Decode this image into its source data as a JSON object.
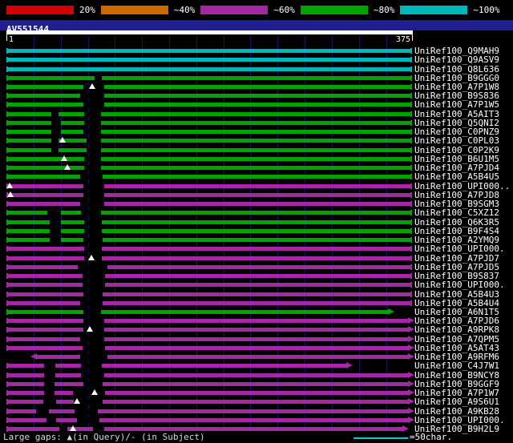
{
  "legend": {
    "segments": [
      {
        "label": "20%",
        "color": "#d40000"
      },
      {
        "label": "~40%",
        "color": "#cc6a00"
      },
      {
        "label": "~60%",
        "color": "#a428a4"
      },
      {
        "label": "~80%",
        "color": "#00a300"
      },
      {
        "label": "~100%",
        "color": "#00b7b7"
      }
    ]
  },
  "query": {
    "name": "AV551544",
    "start_label": "1",
    "end_label": "375",
    "length": 375
  },
  "footer": {
    "gaps_note": "Large gaps: ▲(in Query)/- (in Subject)",
    "scale_note": "=50char.",
    "scale_chars": 50
  },
  "colors": {
    "background": "#000000",
    "grid": "#15155d",
    "ruler_band": "#1f1f8f",
    "scale_line": "#00cccc",
    "text": "#ffffff"
  },
  "chart_data": {
    "type": "bar",
    "subtype": "blast-alignment-overview",
    "title": "AV551544",
    "x_axis": {
      "label": "query position",
      "min": 1,
      "max": 375,
      "gridline_interval": 25
    },
    "legend_position": "top",
    "band_colors": {
      "20%": "#d40000",
      "~40%": "#cc6a00",
      "~60%": "#a428a4",
      "~80%": "#00a300",
      "~100%": "#00b7b7"
    },
    "hits": [
      {
        "label": "UniRef100_Q9MAH9",
        "band": "~100%",
        "q_start": 1,
        "q_end": 375
      },
      {
        "label": "UniRef100_Q9ASV9",
        "band": "~100%",
        "q_start": 1,
        "q_end": 375
      },
      {
        "label": "UniRef100_Q8L636",
        "band": "~100%",
        "q_start": 1,
        "q_end": 375
      },
      {
        "label": "UniRef100_B9GGG0",
        "band": "~80%",
        "q_start": 1,
        "q_end": 375,
        "gaps": [
          [
            82,
            7
          ]
        ]
      },
      {
        "label": "UniRef100_A7P1W8",
        "band": "~80%",
        "q_start": 1,
        "q_end": 375,
        "gaps": [
          [
            72,
            19
          ]
        ],
        "query_gap_marks": [
          80
        ]
      },
      {
        "label": "UniRef100_B9S836",
        "band": "~80%",
        "q_start": 1,
        "q_end": 375,
        "gaps": [
          [
            69,
            22
          ]
        ]
      },
      {
        "label": "UniRef100_A7P1W5",
        "band": "~80%",
        "q_start": 1,
        "q_end": 375,
        "gaps": [
          [
            72,
            19
          ]
        ]
      },
      {
        "label": "UniRef100_A5AIT3",
        "band": "~80%",
        "q_start": 1,
        "q_end": 375,
        "gaps": [
          [
            42,
            7
          ],
          [
            73,
            15
          ]
        ]
      },
      {
        "label": "UniRef100_Q5QNI2",
        "band": "~80%",
        "q_start": 1,
        "q_end": 375,
        "gaps": [
          [
            42,
            9
          ],
          [
            73,
            15
          ]
        ]
      },
      {
        "label": "UniRef100_C0PNZ9",
        "band": "~80%",
        "q_start": 1,
        "q_end": 375,
        "gaps": [
          [
            42,
            9
          ],
          [
            72,
            16
          ]
        ]
      },
      {
        "label": "UniRef100_C0PL03",
        "band": "~80%",
        "q_start": 1,
        "q_end": 375,
        "gaps": [
          [
            42,
            7
          ],
          [
            75,
            13
          ]
        ],
        "query_gap_marks": [
          53
        ]
      },
      {
        "label": "UniRef100_C0P2K9",
        "band": "~80%",
        "q_start": 1,
        "q_end": 375,
        "gaps": [
          [
            42,
            7
          ],
          [
            75,
            13
          ]
        ]
      },
      {
        "label": "UniRef100_B6U1M5",
        "band": "~80%",
        "q_start": 1,
        "q_end": 375,
        "gaps": [
          [
            73,
            15
          ]
        ],
        "query_gap_marks": [
          54
        ]
      },
      {
        "label": "UniRef100_A7PJD4",
        "band": "~80%",
        "q_start": 1,
        "q_end": 375,
        "gaps": [
          [
            73,
            15
          ]
        ],
        "query_gap_marks": [
          57
        ]
      },
      {
        "label": "UniRef100_A5B4U5",
        "band": "~80%",
        "q_start": 1,
        "q_end": 375,
        "gaps": [
          [
            69,
            21
          ]
        ]
      },
      {
        "label": "UniRef100_UPI000..",
        "band": "~60%",
        "q_start": 1,
        "q_end": 375,
        "gaps": [
          [
            72,
            19
          ]
        ],
        "query_gap_marks": [
          4
        ]
      },
      {
        "label": "UniRef100_A7PJD8",
        "band": "~60%",
        "q_start": 1,
        "q_end": 375,
        "gaps": [
          [
            72,
            19
          ]
        ],
        "query_gap_marks": [
          5
        ]
      },
      {
        "label": "UniRef100_B9SGM3",
        "band": "~60%",
        "q_start": 1,
        "q_end": 375,
        "gaps": [
          [
            69,
            22
          ]
        ]
      },
      {
        "label": "UniRef100_C5XZ12",
        "band": "~80%",
        "q_start": 1,
        "q_end": 375,
        "gaps": [
          [
            39,
            12
          ],
          [
            70,
            18
          ]
        ]
      },
      {
        "label": "UniRef100_Q6K3R5",
        "band": "~80%",
        "q_start": 1,
        "q_end": 375,
        "gaps": [
          [
            41,
            10
          ],
          [
            73,
            16
          ]
        ]
      },
      {
        "label": "UniRef100_B9F4S4",
        "band": "~80%",
        "q_start": 1,
        "q_end": 375,
        "gaps": [
          [
            41,
            10
          ],
          [
            73,
            16
          ]
        ]
      },
      {
        "label": "UniRef100_A2YMQ9",
        "band": "~80%",
        "q_start": 1,
        "q_end": 375,
        "gaps": [
          [
            41,
            10
          ],
          [
            72,
            18
          ]
        ]
      },
      {
        "label": "UniRef100_UPI000.",
        "band": "~60%",
        "q_start": 1,
        "q_end": 375,
        "gaps": [
          [
            73,
            16
          ]
        ]
      },
      {
        "label": "UniRef100_A7PJD7",
        "band": "~60%",
        "q_start": 1,
        "q_end": 375,
        "gaps": [
          [
            73,
            16
          ]
        ],
        "query_gap_marks": [
          79
        ]
      },
      {
        "label": "UniRef100_A7PJD5",
        "band": "~60%",
        "q_start": 1,
        "q_end": 375,
        "gaps": [
          [
            67,
            27
          ]
        ]
      },
      {
        "label": "UniRef100_B9S837",
        "band": "~60%",
        "q_start": 1,
        "q_end": 375,
        "gaps": [
          [
            71,
            21
          ]
        ]
      },
      {
        "label": "UniRef100_UPI000.",
        "band": "~60%",
        "q_start": 1,
        "q_end": 375,
        "gaps": [
          [
            71,
            21
          ]
        ]
      },
      {
        "label": "UniRef100_A5B4U3",
        "band": "~60%",
        "q_start": 1,
        "q_end": 375,
        "gaps": [
          [
            72,
            18
          ]
        ]
      },
      {
        "label": "UniRef100_A5B4U4",
        "band": "~60%",
        "q_start": 1,
        "q_end": 375,
        "gaps": [
          [
            69,
            21
          ]
        ]
      },
      {
        "label": "UniRef100_A6N1T5",
        "band": "~80%",
        "q_start": 1,
        "q_end": 353,
        "right_arrow": true,
        "gaps": [
          [
            72,
            16
          ]
        ]
      },
      {
        "label": "UniRef100_A7PJD6",
        "band": "~60%",
        "q_start": 1,
        "q_end": 371,
        "right_arrow": true,
        "gaps": [
          [
            72,
            19
          ]
        ]
      },
      {
        "label": "UniRef100_A9RPK8",
        "band": "~60%",
        "q_start": 1,
        "q_end": 371,
        "right_arrow": true,
        "gaps": [
          [
            72,
            19
          ]
        ],
        "query_gap_marks": [
          78
        ]
      },
      {
        "label": "UniRef100_A7QPM5",
        "band": "~60%",
        "q_start": 1,
        "q_end": 371,
        "right_arrow": true,
        "gaps": [
          [
            69,
            22
          ]
        ]
      },
      {
        "label": "UniRef100_A5AT43",
        "band": "~60%",
        "q_start": 1,
        "q_end": 371,
        "right_arrow": true,
        "gaps": [
          [
            71,
            21
          ]
        ]
      },
      {
        "label": "UniRef100_A9RFM6",
        "band": "~60%",
        "q_start": 29,
        "q_end": 371,
        "left_arrow": true,
        "right_arrow": true,
        "gaps": [
          [
            69,
            25
          ]
        ]
      },
      {
        "label": "UniRef100_C4J7W1",
        "band": "~60%",
        "q_start": 1,
        "q_end": 314,
        "right_arrow": true,
        "gaps": [
          [
            36,
            10
          ],
          [
            70,
            19
          ]
        ]
      },
      {
        "label": "UniRef100_B9NCY8",
        "band": "~60%",
        "q_start": 1,
        "q_end": 371,
        "right_arrow": true,
        "gaps": [
          [
            36,
            10
          ],
          [
            70,
            21
          ]
        ]
      },
      {
        "label": "UniRef100_B9GGF9",
        "band": "~60%",
        "q_start": 1,
        "q_end": 371,
        "right_arrow": true,
        "gaps": [
          [
            36,
            9
          ],
          [
            72,
            18
          ]
        ]
      },
      {
        "label": "UniRef100_A7P1W7",
        "band": "~60%",
        "q_start": 1,
        "q_end": 371,
        "right_arrow": true,
        "gaps": [
          [
            36,
            9
          ],
          [
            62,
            30
          ]
        ],
        "query_gap_marks": [
          82
        ]
      },
      {
        "label": "UniRef100_A9S6U1",
        "band": "~60%",
        "q_start": 1,
        "q_end": 371,
        "right_arrow": true,
        "gaps": [
          [
            35,
            12
          ],
          [
            63,
            27
          ]
        ],
        "query_gap_marks": [
          66
        ]
      },
      {
        "label": "UniRef100_A9KB28",
        "band": "~60%",
        "q_start": 1,
        "q_end": 371,
        "right_arrow": true,
        "gaps": [
          [
            28,
            12
          ],
          [
            64,
            21
          ]
        ]
      },
      {
        "label": "UniRef100_UPI000.",
        "band": "~60%",
        "q_start": 1,
        "q_end": 371,
        "right_arrow": true,
        "gaps": [
          [
            38,
            9
          ],
          [
            66,
            21
          ]
        ]
      },
      {
        "label": "UniRef100_B9H2L9",
        "band": "~60%",
        "q_start": 1,
        "q_end": 366,
        "right_arrow": true,
        "gaps": [
          [
            50,
            7
          ],
          [
            81,
            10
          ]
        ],
        "query_gap_marks": [
          62
        ]
      }
    ]
  }
}
